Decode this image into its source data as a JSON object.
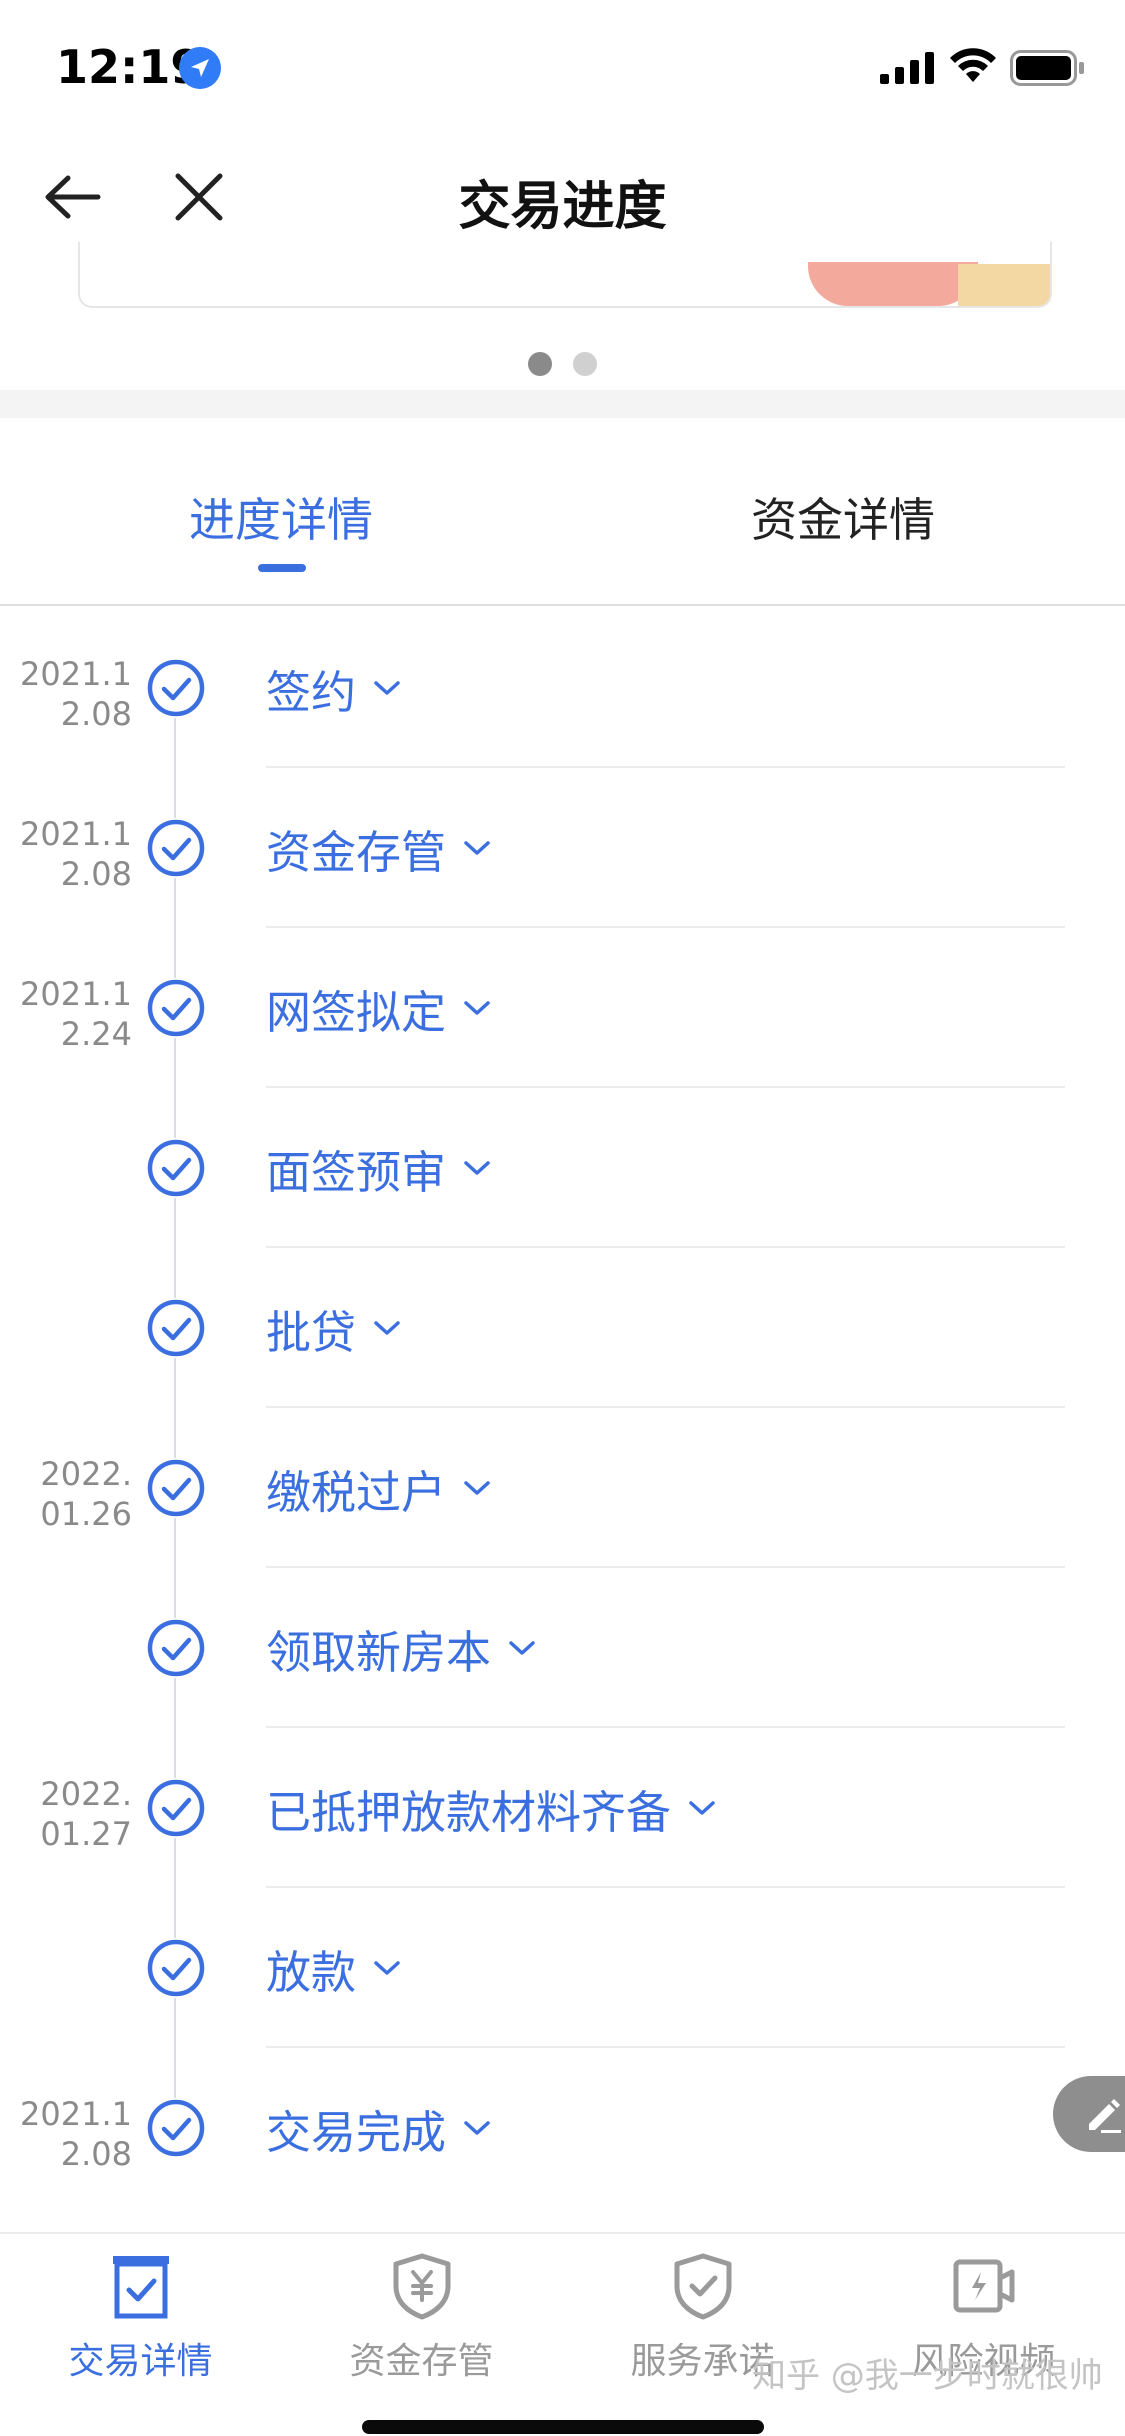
{
  "status_bar": {
    "time": "12:19"
  },
  "nav": {
    "title": "交易进度",
    "back_icon": "back-arrow-icon",
    "close_icon": "close-icon"
  },
  "carousel": {
    "page_count": 2,
    "active_index": 0
  },
  "tabs": [
    {
      "label": "进度详情",
      "active": true
    },
    {
      "label": "资金详情",
      "active": false
    }
  ],
  "timeline": [
    {
      "date_line1": "2021.1",
      "date_line2": "2.08",
      "label": "签约"
    },
    {
      "date_line1": "2021.1",
      "date_line2": "2.08",
      "label": "资金存管"
    },
    {
      "date_line1": "2021.1",
      "date_line2": "2.24",
      "label": "网签拟定"
    },
    {
      "date_line1": "",
      "date_line2": "",
      "label": "面签预审"
    },
    {
      "date_line1": "",
      "date_line2": "",
      "label": "批贷"
    },
    {
      "date_line1": "2022.",
      "date_line2": "01.26",
      "label": "缴税过户"
    },
    {
      "date_line1": "",
      "date_line2": "",
      "label": "领取新房本"
    },
    {
      "date_line1": "2022.",
      "date_line2": "01.27",
      "label": "已抵押放款材料齐备"
    },
    {
      "date_line1": "",
      "date_line2": "",
      "label": "放款"
    },
    {
      "date_line1": "2021.1",
      "date_line2": "2.08",
      "label": "交易完成"
    }
  ],
  "bottom_nav": [
    {
      "label": "交易详情",
      "icon": "clipboard-check-icon",
      "active": true
    },
    {
      "label": "资金存管",
      "icon": "yuan-shield-icon",
      "active": false
    },
    {
      "label": "服务承诺",
      "icon": "check-shield-icon",
      "active": false
    },
    {
      "label": "风险视频",
      "icon": "video-camera-icon",
      "active": false
    }
  ],
  "watermark": "知乎 @我一步时就很帅",
  "colors": {
    "accent": "#3b6fe0",
    "inactive": "#9a9a9a",
    "date_text": "#8a8a8a"
  }
}
